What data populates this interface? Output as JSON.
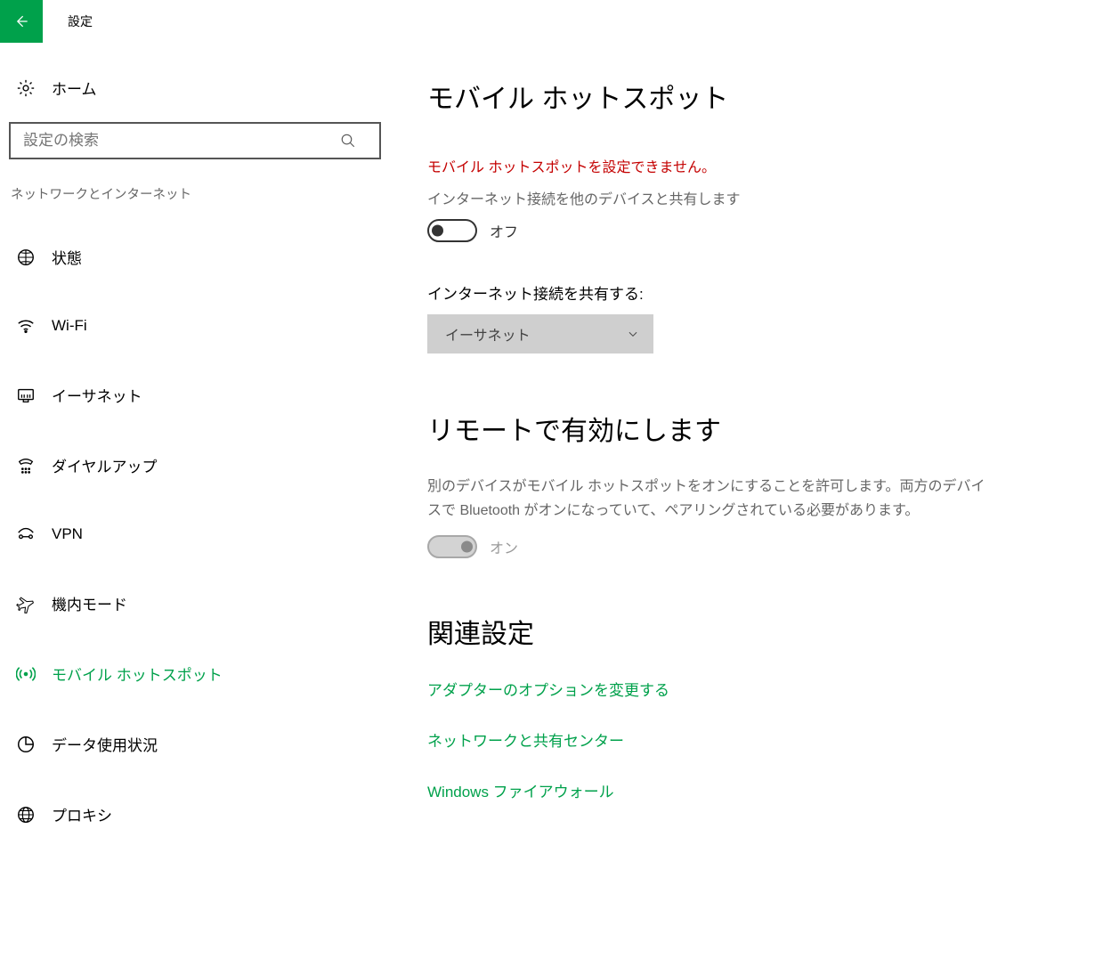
{
  "title": "設定",
  "sidebar": {
    "home_label": "ホーム",
    "search_placeholder": "設定の検索",
    "category": "ネットワークとインターネット",
    "items": [
      {
        "label": "状態"
      },
      {
        "label": "Wi-Fi"
      },
      {
        "label": "イーサネット"
      },
      {
        "label": "ダイヤルアップ"
      },
      {
        "label": "VPN"
      },
      {
        "label": "機内モード"
      },
      {
        "label": "モバイル ホットスポット"
      },
      {
        "label": "データ使用状況"
      },
      {
        "label": "プロキシ"
      }
    ]
  },
  "main": {
    "page_title": "モバイル ホットスポット",
    "error": "モバイル ホットスポットを設定できません。",
    "share_desc": "インターネット接続を他のデバイスと共有します",
    "share_toggle_state": "オフ",
    "share_from_label": "インターネット接続を共有する:",
    "share_from_value": "イーサネット",
    "remote_title": "リモートで有効にします",
    "remote_desc": "別のデバイスがモバイル ホットスポットをオンにすることを許可します。両方のデバイスで Bluetooth がオンになっていて、ペアリングされている必要があります。",
    "remote_toggle_state": "オン",
    "related_title": "関連設定",
    "related_links": [
      "アダプターのオプションを変更する",
      "ネットワークと共有センター",
      "Windows ファイアウォール"
    ]
  }
}
